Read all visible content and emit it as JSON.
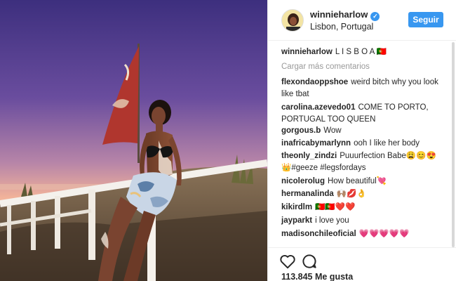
{
  "post": {
    "username": "winnieharlow",
    "location": "Lisbon, Portugal",
    "follow_label": "Seguir",
    "caption_user": "winnieharlow",
    "caption_text": "L I S B O A 🇵🇹",
    "load_more": "Cargar más comentarios",
    "likes": "113.845 Me gusta"
  },
  "comments": [
    {
      "user": "flexondaoppshoe",
      "text": "weird bitch why you look like tbat"
    },
    {
      "user": "carolina.azevedo01",
      "text": "COME TO PORTO, PORTUGAL TOO QUEEN"
    },
    {
      "user": "gorgous.b",
      "text": "Wow"
    },
    {
      "user": "inafricabymarlynn",
      "text": "ooh I like her body"
    },
    {
      "user": "theonly_zindzi",
      "text": "Puuurfection Babe😩😊😍 👑#geeze #legsfordays"
    },
    {
      "user": "nicolerolug",
      "text": "How beautiful💘"
    },
    {
      "user": "hermanalinda",
      "text": "🙌🏽💋👌"
    },
    {
      "user": "kikirdlm",
      "text": "🇵🇹🇵🇹❤️❤️"
    },
    {
      "user": "jayparkt",
      "text": "i love you"
    },
    {
      "user": "madisonchileoficial",
      "text": "💗💗💗💗💗"
    }
  ],
  "icons": {
    "verified": "verified-badge-icon",
    "like": "heart-outline-icon",
    "comment": "speech-bubble-icon"
  },
  "colors": {
    "accent": "#3897f0",
    "text": "#262626",
    "muted": "#999999"
  }
}
